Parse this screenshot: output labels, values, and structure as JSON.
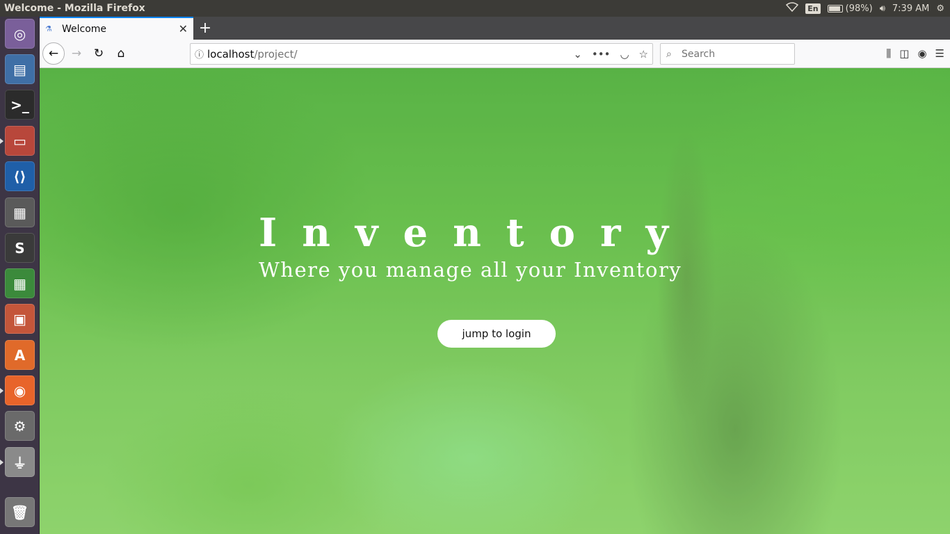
{
  "system": {
    "window_title": "Welcome - Mozilla Firefox",
    "keyboard_lang": "En",
    "battery": "(98%)",
    "time": "7:39 AM"
  },
  "launcher": {
    "items": [
      {
        "name": "ubuntu-dash",
        "color": "#7a5f9a",
        "glyph": "◎"
      },
      {
        "name": "image-viewer",
        "color": "#3f6fa6",
        "glyph": "▤"
      },
      {
        "name": "terminal",
        "color": "#2b2b2b",
        "glyph": ">_"
      },
      {
        "name": "files",
        "color": "#b8473b",
        "glyph": "▭"
      },
      {
        "name": "vscode",
        "color": "#1f5fa8",
        "glyph": "⟨⟩"
      },
      {
        "name": "office-tiles",
        "color": "#5a5a5a",
        "glyph": "▦"
      },
      {
        "name": "sublime-text",
        "color": "#3a3a3a",
        "glyph": "S"
      },
      {
        "name": "spreadsheet",
        "color": "#3b8a3b",
        "glyph": "▦"
      },
      {
        "name": "presentation",
        "color": "#c4563a",
        "glyph": "▣"
      },
      {
        "name": "software-center",
        "color": "#e06a2a",
        "glyph": "A"
      },
      {
        "name": "firefox",
        "color": "#e8642a",
        "glyph": "◉"
      },
      {
        "name": "system-settings",
        "color": "#6a6a6a",
        "glyph": "⚙"
      },
      {
        "name": "usb-drive",
        "color": "#8a8a8a",
        "glyph": "⏚"
      },
      {
        "name": "trash",
        "color": "#777777",
        "glyph": "🗑"
      }
    ]
  },
  "browser": {
    "tab_title": "Welcome",
    "new_tab": "+",
    "url_host": "localhost",
    "url_path": "/project/",
    "search_placeholder": "Search"
  },
  "page": {
    "title": "Inventory",
    "subtitle": "Where you manage all your Inventory",
    "login_button": "jump to login"
  }
}
